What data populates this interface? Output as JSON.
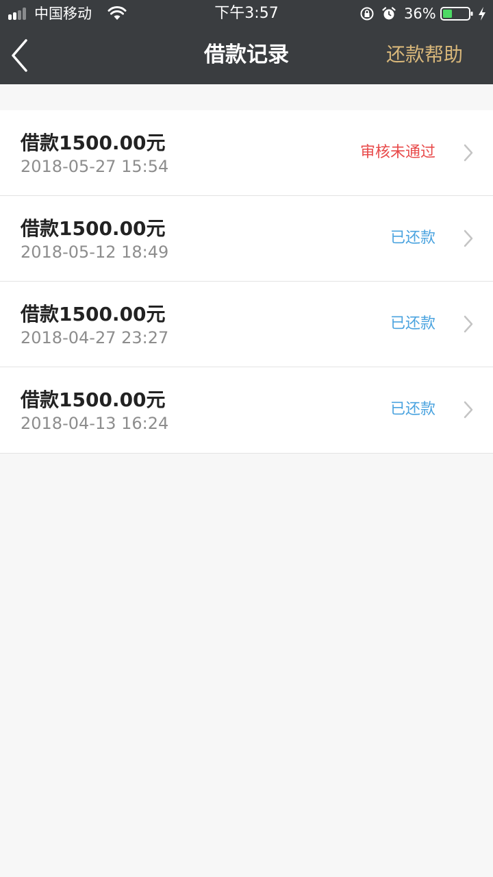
{
  "status_bar": {
    "carrier": "中国移动",
    "time": "下午3:57",
    "battery_percent": "36%",
    "battery_level": 0.36,
    "battery_color": "#4cd964"
  },
  "nav": {
    "title": "借款记录",
    "help_label": "还款帮助",
    "help_color": "#d8b77a"
  },
  "records": [
    {
      "amount": "借款1500.00元",
      "datetime": "2018-05-27 15:54",
      "status": "审核未通过",
      "status_color": "#e84a4a"
    },
    {
      "amount": "借款1500.00元",
      "datetime": "2018-05-12 18:49",
      "status": "已还款",
      "status_color": "#4aa3df"
    },
    {
      "amount": "借款1500.00元",
      "datetime": "2018-04-27 23:27",
      "status": "已还款",
      "status_color": "#4aa3df"
    },
    {
      "amount": "借款1500.00元",
      "datetime": "2018-04-13 16:24",
      "status": "已还款",
      "status_color": "#4aa3df"
    }
  ],
  "icons": {
    "back": "chevron-left-icon",
    "row_arrow": "chevron-right-icon",
    "signal": "cellular-signal-icon",
    "wifi": "wifi-icon",
    "rotation_lock": "rotation-lock-icon",
    "alarm": "alarm-icon",
    "battery": "battery-icon",
    "charging": "charging-bolt-icon"
  }
}
